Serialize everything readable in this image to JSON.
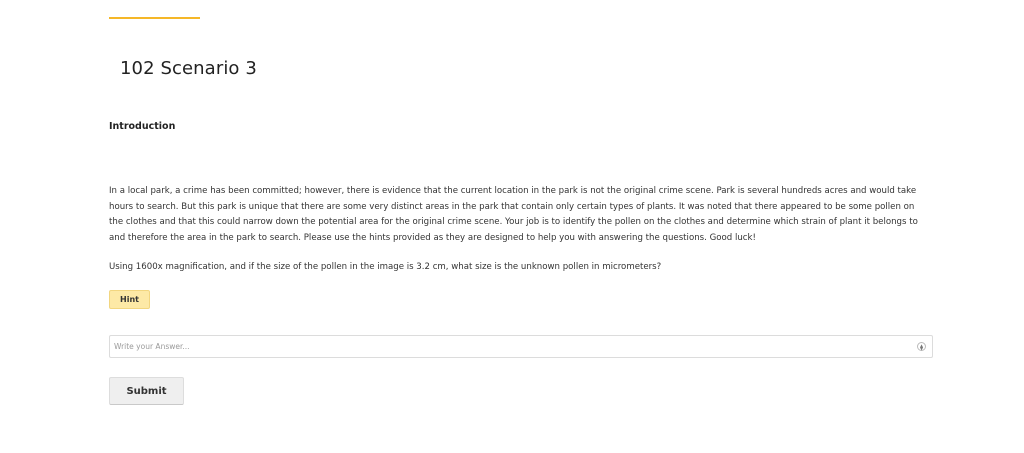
{
  "page": {
    "title": "102 Scenario 3",
    "accent_color": "#f5b728"
  },
  "section": {
    "heading": "Introduction",
    "body": "In a local park, a crime has been committed; however, there is evidence that the current location in the park is not the original crime scene. Park is several hundreds acres and would take hours to search. But this park is unique that there are some very distinct areas in the park that contain only certain types of plants. It was noted that there appeared to be some pollen on the clothes and that this could narrow down the potential area for the original crime scene. Your job is to identify the pollen on the clothes and determine which strain of plant it belongs to and therefore the area in the park to search. Please use the hints provided as they are designed to help you with answering the questions. Good luck!"
  },
  "question": {
    "text": "Using 1600x magnification, and if the size of the pollen in the image is 3.2 cm, what size is the unknown pollen in micrometers?",
    "hint_label": "Hint",
    "hint_color": "#fde9a6",
    "answer_value": "",
    "answer_placeholder": "Write your Answer...",
    "stepper_icon": "stepper-icon",
    "submit_label": "Submit"
  }
}
